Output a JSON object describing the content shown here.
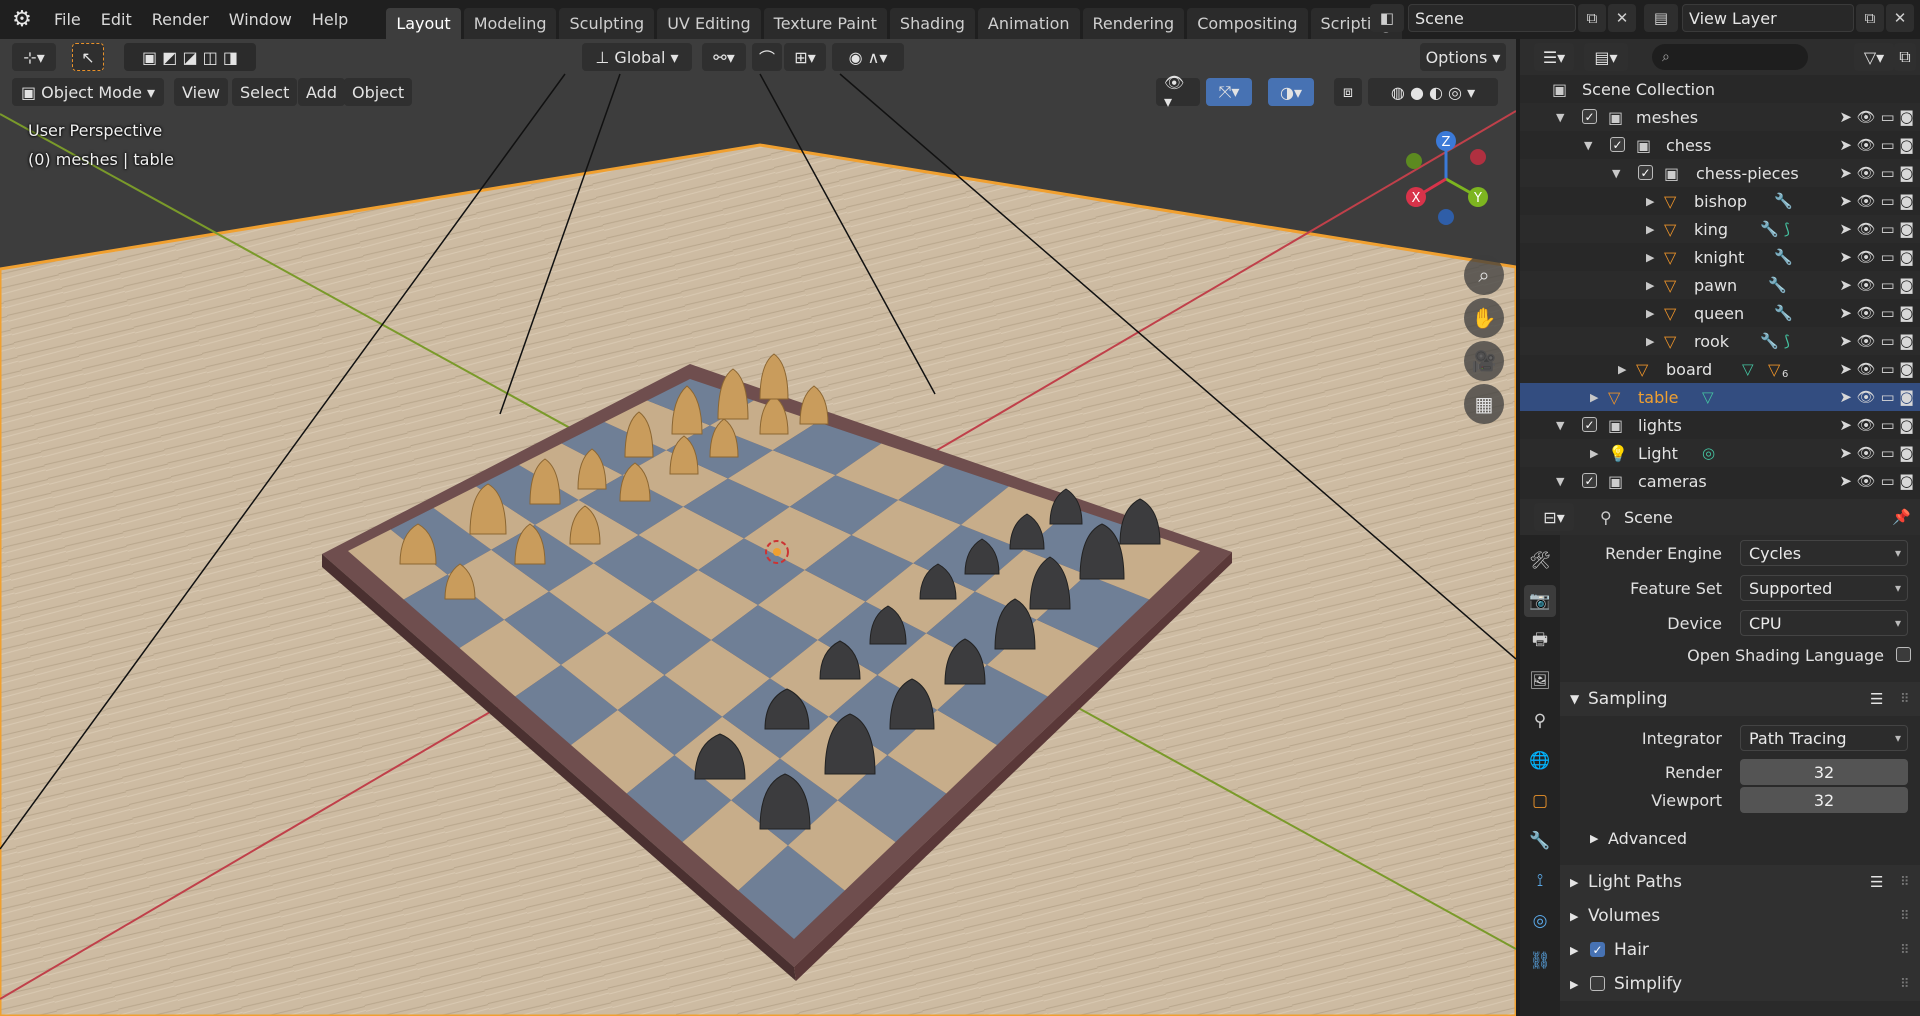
{
  "menu": [
    "File",
    "Edit",
    "Render",
    "Window",
    "Help"
  ],
  "workspaces": [
    "Layout",
    "Modeling",
    "Sculpting",
    "UV Editing",
    "Texture Paint",
    "Shading",
    "Animation",
    "Rendering",
    "Compositing",
    "Scripting"
  ],
  "active_workspace": "Layout",
  "scene_name": "Scene",
  "view_layer_name": "View Layer",
  "viewport": {
    "transform_orientation": "Global",
    "options_label": "Options",
    "mode": "Object Mode",
    "header_menus": [
      "View",
      "Select",
      "Add",
      "Object"
    ],
    "perspective_label": "User Perspective",
    "object_info": "(0) meshes | table",
    "gizmo_axes": {
      "z": "Z",
      "x": "X",
      "y": "Y"
    }
  },
  "outliner": {
    "search_placeholder": "",
    "rows": [
      {
        "label": "Scene Collection"
      },
      {
        "label": "meshes"
      },
      {
        "label": "chess"
      },
      {
        "label": "chess-pieces"
      },
      {
        "label": "bishop"
      },
      {
        "label": "king"
      },
      {
        "label": "knight"
      },
      {
        "label": "pawn"
      },
      {
        "label": "queen"
      },
      {
        "label": "rook"
      },
      {
        "label": "board",
        "badge": "6"
      },
      {
        "label": "table"
      },
      {
        "label": "lights"
      },
      {
        "label": "Light"
      },
      {
        "label": "cameras"
      }
    ]
  },
  "properties": {
    "context_title": "Scene",
    "render_engine_label": "Render Engine",
    "render_engine": "Cycles",
    "feature_set_label": "Feature Set",
    "feature_set": "Supported",
    "device_label": "Device",
    "device": "CPU",
    "osl_label": "Open Shading Language",
    "sampling_label": "Sampling",
    "integrator_label": "Integrator",
    "integrator": "Path Tracing",
    "render_samples_label": "Render",
    "render_samples": "32",
    "viewport_samples_label": "Viewport",
    "viewport_samples": "32",
    "advanced_label": "Advanced",
    "light_paths_label": "Light Paths",
    "volumes_label": "Volumes",
    "hair_label": "Hair",
    "simplify_label": "Simplify"
  },
  "colors": {
    "accent": "#4772b3",
    "selected_row": "#334d80",
    "object_orange": "#e8912a",
    "table_highlight": "#f0a030"
  }
}
